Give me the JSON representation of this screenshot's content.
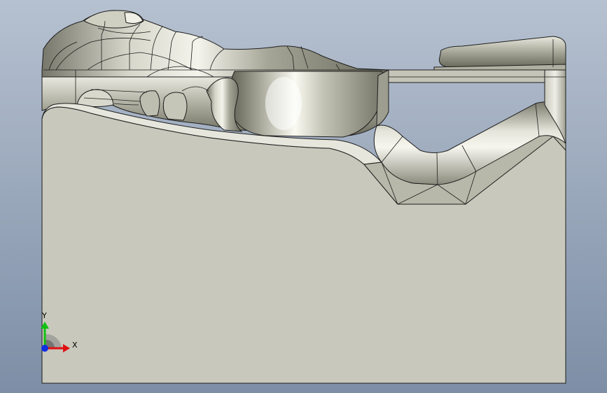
{
  "viewport": {
    "background_top": "#b6c1d0",
    "background_bottom": "#7d8ea6"
  },
  "model": {
    "face_color": "#c8c8bc",
    "edge_color": "#1e1e1e",
    "surface_light": "#f2f2ea",
    "surface_dark": "#6e6e5e"
  },
  "triad": {
    "x_label": "X",
    "y_label": "Y",
    "x_color": "#e01010",
    "y_color": "#10c010",
    "z_color": "#1030e0"
  }
}
